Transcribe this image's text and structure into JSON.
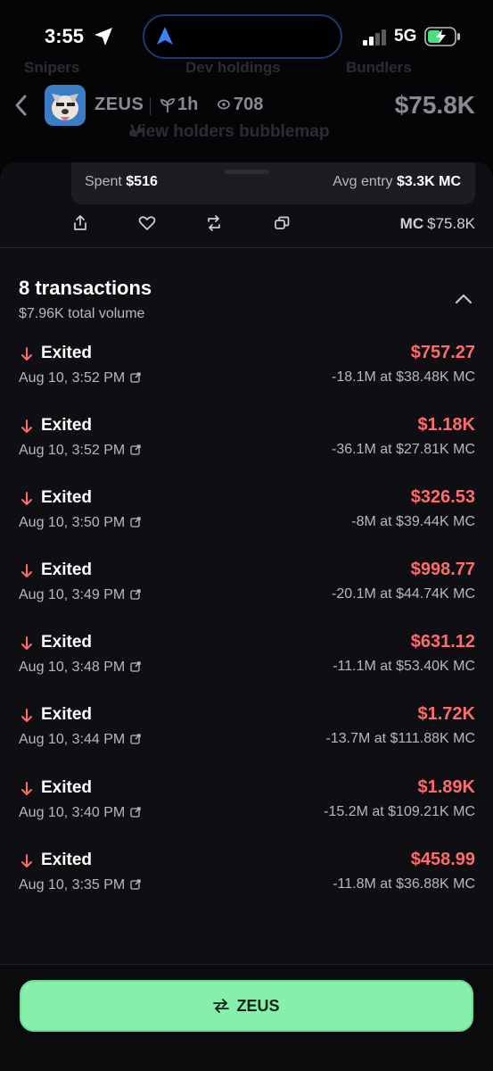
{
  "status_bar": {
    "time": "3:55",
    "network": "5G"
  },
  "background": {
    "tabs": [
      "Snipers",
      "Dev holdings",
      "Bundlers"
    ],
    "token_name": "ZEUS",
    "age": "1h",
    "views": "708",
    "market_cap": "$75.8K",
    "bubblemap_label": "View holders bubblemap"
  },
  "position": {
    "spent_label": "Spent",
    "spent_value": "$516",
    "avg_entry_label": "Avg entry",
    "avg_entry_value": "$3.3K MC"
  },
  "actions": {
    "icons": [
      "share-icon",
      "heart-icon",
      "repost-icon",
      "copy-icon"
    ],
    "mc_label": "MC",
    "mc_value": "$75.8K"
  },
  "transactions": {
    "title": "8 transactions",
    "volume": "$7.96K total volume",
    "items": [
      {
        "type": "Exited",
        "date": "Aug 10, 3:52 PM",
        "amount": "$757.27",
        "detail": "-18.1M at $38.48K MC"
      },
      {
        "type": "Exited",
        "date": "Aug 10, 3:52 PM",
        "amount": "$1.18K",
        "detail": "-36.1M at $27.81K MC"
      },
      {
        "type": "Exited",
        "date": "Aug 10, 3:50 PM",
        "amount": "$326.53",
        "detail": "-8M at $39.44K MC"
      },
      {
        "type": "Exited",
        "date": "Aug 10, 3:49 PM",
        "amount": "$998.77",
        "detail": "-20.1M at $44.74K MC"
      },
      {
        "type": "Exited",
        "date": "Aug 10, 3:48 PM",
        "amount": "$631.12",
        "detail": "-11.1M at $53.40K MC"
      },
      {
        "type": "Exited",
        "date": "Aug 10, 3:44 PM",
        "amount": "$1.72K",
        "detail": "-13.7M at $111.88K MC"
      },
      {
        "type": "Exited",
        "date": "Aug 10, 3:40 PM",
        "amount": "$1.89K",
        "detail": "-15.2M at $109.21K MC"
      },
      {
        "type": "Exited",
        "date": "Aug 10, 3:35 PM",
        "amount": "$458.99",
        "detail": "-11.8M at $36.88K MC"
      }
    ]
  },
  "bottom": {
    "swap_label": "ZEUS"
  },
  "colors": {
    "accent": "#86efac",
    "sell": "#ff6b6b",
    "sheet": "#0f0f13"
  }
}
